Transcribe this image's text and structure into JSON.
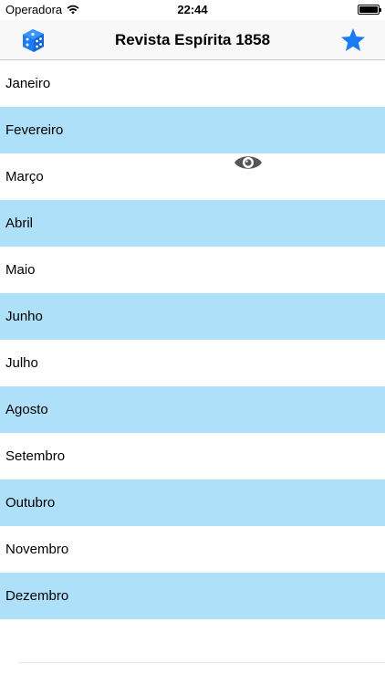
{
  "status_bar": {
    "carrier": "Operadora",
    "time": "22:44"
  },
  "nav": {
    "title": "Revista Espírita 1858",
    "left_icon": "dice-icon",
    "right_icon": "star-icon",
    "accent_color": "#1a7cf5"
  },
  "months": [
    {
      "label": "Janeiro"
    },
    {
      "label": "Fevereiro"
    },
    {
      "label": "Março"
    },
    {
      "label": "Abril"
    },
    {
      "label": "Maio"
    },
    {
      "label": "Junho"
    },
    {
      "label": "Julho"
    },
    {
      "label": "Agosto"
    },
    {
      "label": "Setembro"
    },
    {
      "label": "Outubro"
    },
    {
      "label": "Novembro"
    },
    {
      "label": "Dezembro"
    }
  ],
  "colors": {
    "alt_row": "#aee0fa",
    "plain_row": "#ffffff"
  }
}
